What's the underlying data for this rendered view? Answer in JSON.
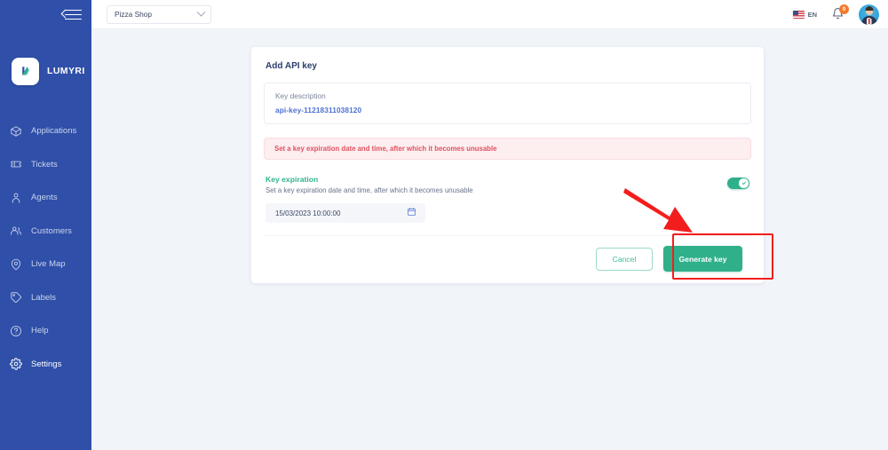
{
  "sidebar": {
    "collapse_icon": "hamburger-collapse-icon",
    "brand": {
      "name": "LUMYRI",
      "logo_icon": "lumyri-logo-icon"
    },
    "items": [
      {
        "label": "Applications",
        "icon": "box-icon"
      },
      {
        "label": "Tickets",
        "icon": "ticket-icon"
      },
      {
        "label": "Agents",
        "icon": "agent-icon"
      },
      {
        "label": "Customers",
        "icon": "customers-icon"
      },
      {
        "label": "Live Map",
        "icon": "map-pin-icon"
      },
      {
        "label": "Labels",
        "icon": "tag-icon"
      },
      {
        "label": "Help",
        "icon": "help-circle-icon"
      },
      {
        "label": "Settings",
        "icon": "gear-icon"
      }
    ]
  },
  "topbar": {
    "shop_select": {
      "value": "Pizza Shop",
      "chevron_icon": "chevron-down-icon"
    },
    "language": {
      "label": "EN",
      "flag_icon": "us-flag-icon"
    },
    "notifications": {
      "count": "0",
      "icon": "bell-icon"
    },
    "avatar_icon": "user-avatar"
  },
  "card": {
    "title": "Add API key",
    "description": {
      "label": "Key description",
      "value": "api-key-11218311038120"
    },
    "alert": "Set a key expiration date and time, after which it becomes unusable",
    "expiration": {
      "title": "Key expiration",
      "subtitle": "Set a key expiration date and time, after which it becomes unusable",
      "date_value": "15/03/2023 10:00:00",
      "calendar_icon": "calendar-icon",
      "toggle_state": "on",
      "toggle_icon": "check-icon"
    },
    "actions": {
      "cancel_label": "Cancel",
      "generate_label": "Generate key"
    }
  },
  "annotations": {
    "highlight_color": "#f41d1d",
    "arrow_target": "generate-key-button"
  },
  "colors": {
    "sidebar_bg": "#2f4fa8",
    "accent_green": "#2fb08a",
    "accent_blue": "#4e6fd1",
    "alert_red": "#e05260",
    "page_bg": "#f1f4f9"
  }
}
